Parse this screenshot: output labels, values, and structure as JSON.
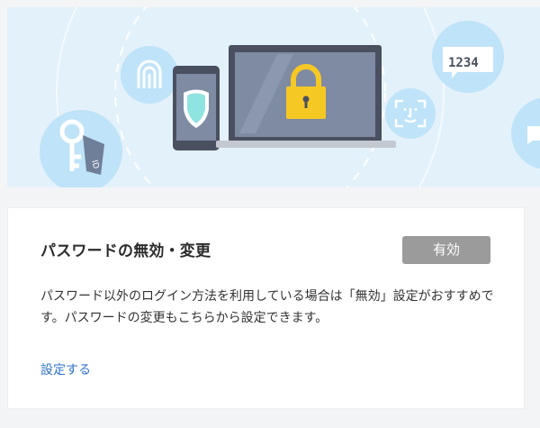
{
  "illustration": {
    "pin_code_text": "1234",
    "key_tag_text": "ID"
  },
  "card": {
    "title": "パスワードの無効・変更",
    "status_badge": "有効",
    "description": "パスワード以外のログイン方法を利用している場合は「無効」設定がおすすめです。パスワードの変更もこちらから設定できます。",
    "link_label": "設定する"
  },
  "colors": {
    "hero_background": "#e3f1fb",
    "badge_background": "#9b9b9b",
    "link": "#2f72c6",
    "lock": "#f6c824",
    "shield": "#8fe3e1"
  }
}
